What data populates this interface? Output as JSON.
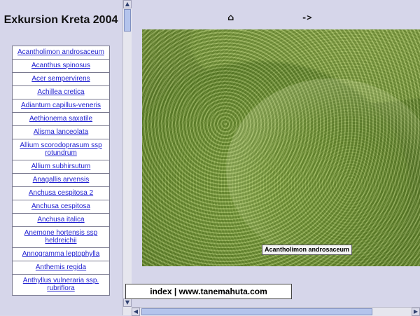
{
  "left": {
    "title": "Exkursion Kreta 2004",
    "species": [
      "Acantholimon androsaceum",
      "Acanthus spinosus",
      "Acer sempervirens",
      "Achillea cretica",
      "Adiantum capillus-veneris",
      "Aethionema saxatile",
      "Alisma lanceolata",
      "Allium scorodoprasum ssp rotundrum",
      "Allium subhirsutum",
      "Anagallis arvensis",
      "Anchusa cespitosa 2",
      "Anchusa cespitosa",
      "Anchusa italica",
      "Anemone hortensis ssp heldreichii",
      "Annogramma leptophylla",
      "Anthemis regida",
      "Anthyllus vulneraria ssp. rubriflora"
    ]
  },
  "right": {
    "nav_up": "⌂",
    "nav_next": "->",
    "caption": "Acantholimon androsaceum",
    "footer_index": "index",
    "footer_sep": " | ",
    "footer_site": "www.tanemahuta.com"
  },
  "scrollbars": {
    "up_glyph": "▲",
    "down_glyph": "▼",
    "left_glyph": "◀",
    "right_glyph": "▶"
  }
}
